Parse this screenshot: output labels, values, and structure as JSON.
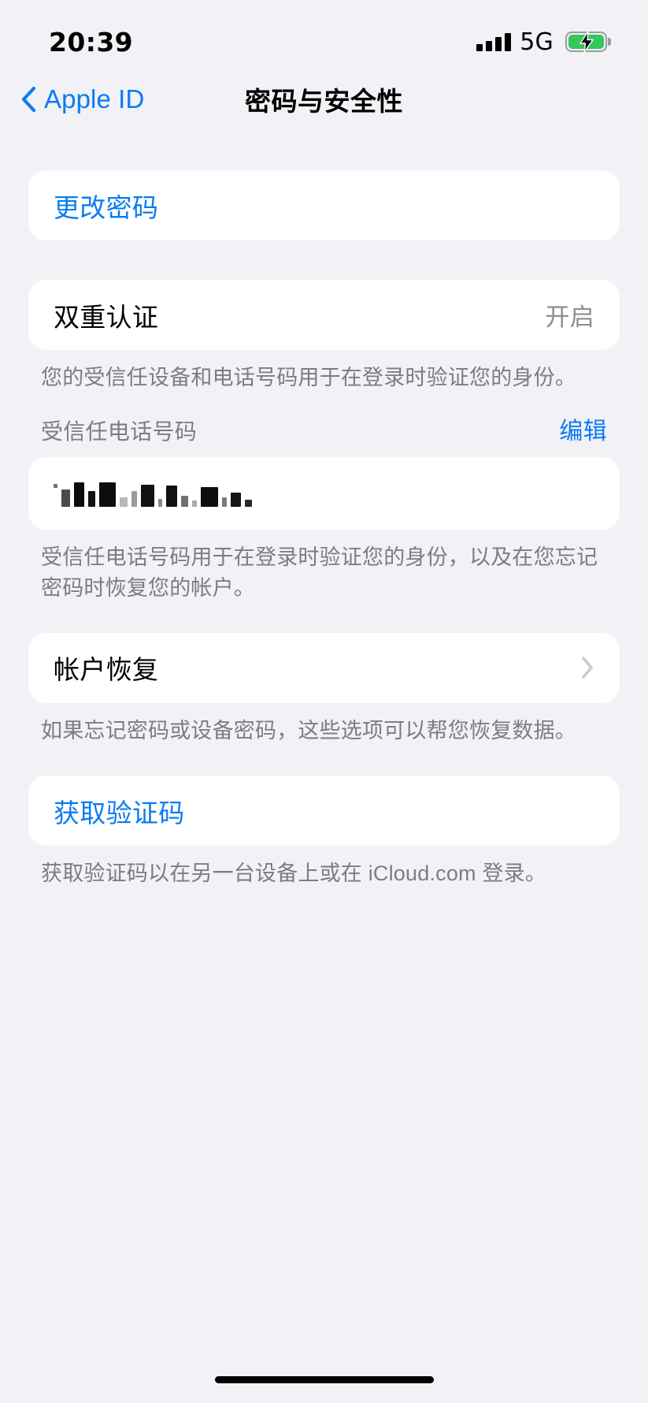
{
  "status_bar": {
    "time": "20:39",
    "network": "5G",
    "signal_icon": "cellular-signal-icon",
    "battery_icon": "battery-charging-icon",
    "battery_color": "#34c759"
  },
  "nav": {
    "back_label": "Apple ID",
    "back_icon": "chevron-left-icon",
    "title": "密码与安全性",
    "accent_color": "#0a7cf1"
  },
  "sections": {
    "change_password": {
      "label": "更改密码"
    },
    "two_factor": {
      "label": "双重认证",
      "value": "开启",
      "footnote": "您的受信任设备和电话号码用于在登录时验证您的身份。"
    },
    "trusted_numbers": {
      "header": "受信任电话号码",
      "edit_label": "编辑",
      "redacted_value": "••• •••• ••••",
      "footnote": "受信任电话号码用于在登录时验证您的身份，以及在您忘记密码时恢复您的帐户。"
    },
    "account_recovery": {
      "label": "帐户恢复",
      "chevron_icon": "chevron-right-icon",
      "footnote": "如果忘记密码或设备密码，这些选项可以帮您恢复数据。"
    },
    "get_verification_code": {
      "label": "获取验证码",
      "footnote": "获取验证码以在另一台设备上或在 iCloud.com 登录。"
    }
  },
  "home_indicator": "home-indicator"
}
